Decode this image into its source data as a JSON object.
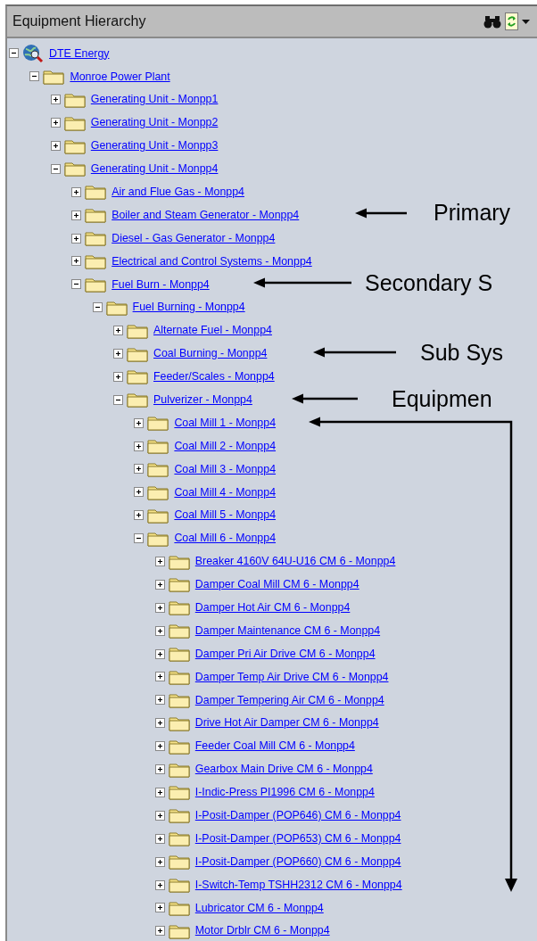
{
  "panel": {
    "title": "Equipment Hierarchy"
  },
  "tree": [
    {
      "label": "DTE Energy",
      "kind": "globe",
      "expanded": true,
      "children": [
        {
          "label": "Monroe Power Plant",
          "kind": "folder",
          "expanded": true,
          "children": [
            {
              "label": "Generating Unit - Monpp1",
              "kind": "folder",
              "expanded": false
            },
            {
              "label": "Generating Unit - Monpp2",
              "kind": "folder",
              "expanded": false
            },
            {
              "label": "Generating Unit - Monpp3",
              "kind": "folder",
              "expanded": false
            },
            {
              "label": "Generating Unit - Monpp4",
              "kind": "folder",
              "expanded": true,
              "children": [
                {
                  "label": "Air and Flue Gas - Monpp4",
                  "kind": "folder",
                  "expanded": false
                },
                {
                  "label": "Boiler and Steam Generator - Monpp4",
                  "kind": "folder",
                  "expanded": false
                },
                {
                  "label": "Diesel - Gas Generator - Monpp4",
                  "kind": "folder",
                  "expanded": false
                },
                {
                  "label": "Electrical and Control Systems - Monpp4",
                  "kind": "folder",
                  "expanded": false
                },
                {
                  "label": "Fuel Burn - Monpp4",
                  "kind": "folder",
                  "expanded": true,
                  "children": [
                    {
                      "label": "Fuel Burning - Monpp4",
                      "kind": "folder",
                      "expanded": true,
                      "children": [
                        {
                          "label": "Alternate Fuel - Monpp4",
                          "kind": "folder",
                          "expanded": false
                        },
                        {
                          "label": "Coal Burning - Monpp4",
                          "kind": "folder",
                          "expanded": false
                        },
                        {
                          "label": "Feeder/Scales - Monpp4",
                          "kind": "folder",
                          "expanded": false
                        },
                        {
                          "label": "Pulverizer - Monpp4",
                          "kind": "folder",
                          "expanded": true,
                          "children": [
                            {
                              "label": "Coal Mill 1 - Monpp4",
                              "kind": "folder",
                              "expanded": false
                            },
                            {
                              "label": "Coal Mill 2 - Monpp4",
                              "kind": "folder",
                              "expanded": false
                            },
                            {
                              "label": "Coal Mill 3 - Monpp4",
                              "kind": "folder",
                              "expanded": false
                            },
                            {
                              "label": "Coal Mill 4 - Monpp4",
                              "kind": "folder",
                              "expanded": false
                            },
                            {
                              "label": "Coal Mill 5 - Monpp4",
                              "kind": "folder",
                              "expanded": false
                            },
                            {
                              "label": "Coal Mill 6 - Monpp4",
                              "kind": "folder",
                              "expanded": true,
                              "children": [
                                {
                                  "label": "Breaker 4160V 64U-U16 CM 6 - Monpp4",
                                  "kind": "folder",
                                  "expanded": false
                                },
                                {
                                  "label": "Damper Coal Mill CM 6 - Monpp4",
                                  "kind": "folder",
                                  "expanded": false
                                },
                                {
                                  "label": "Damper Hot Air CM 6 - Monpp4",
                                  "kind": "folder",
                                  "expanded": false
                                },
                                {
                                  "label": "Damper Maintenance CM 6 - Monpp4",
                                  "kind": "folder",
                                  "expanded": false
                                },
                                {
                                  "label": "Damper Pri Air Drive CM 6 - Monpp4",
                                  "kind": "folder",
                                  "expanded": false
                                },
                                {
                                  "label": "Damper Temp Air Drive CM 6 - Monpp4",
                                  "kind": "folder",
                                  "expanded": false
                                },
                                {
                                  "label": "Damper Tempering Air CM 6 - Monpp4",
                                  "kind": "folder",
                                  "expanded": false
                                },
                                {
                                  "label": "Drive Hot Air Damper CM 6 - Monpp4",
                                  "kind": "folder",
                                  "expanded": false
                                },
                                {
                                  "label": "Feeder Coal Mill CM 6 - Monpp4",
                                  "kind": "folder",
                                  "expanded": false
                                },
                                {
                                  "label": "Gearbox Main Drive CM 6 - Monpp4",
                                  "kind": "folder",
                                  "expanded": false
                                },
                                {
                                  "label": "I-Indic-Press PI1996 CM 6 - Monpp4",
                                  "kind": "folder",
                                  "expanded": false
                                },
                                {
                                  "label": "I-Posit-Damper (POP646) CM 6 - Monpp4",
                                  "kind": "folder",
                                  "expanded": false
                                },
                                {
                                  "label": "I-Posit-Damper (POP653) CM 6 - Monpp4",
                                  "kind": "folder",
                                  "expanded": false
                                },
                                {
                                  "label": "I-Posit-Damper (POP660) CM 6 - Monpp4",
                                  "kind": "folder",
                                  "expanded": false
                                },
                                {
                                  "label": "I-Switch-Temp TSHH2312 CM 6 - Monpp4",
                                  "kind": "folder",
                                  "expanded": false
                                },
                                {
                                  "label": "Lubricator CM 6 - Monpp4",
                                  "kind": "folder",
                                  "expanded": false
                                },
                                {
                                  "label": "Motor Drblr CM 6 - Monpp4",
                                  "kind": "folder",
                                  "expanded": false
                                }
                              ]
                            }
                          ]
                        }
                      ]
                    }
                  ]
                }
              ]
            }
          ]
        }
      ]
    }
  ],
  "annotations": [
    {
      "text": "Primary"
    },
    {
      "text": "Secondary S"
    },
    {
      "text": "Sub Sys"
    },
    {
      "text": "Equipmen"
    }
  ]
}
